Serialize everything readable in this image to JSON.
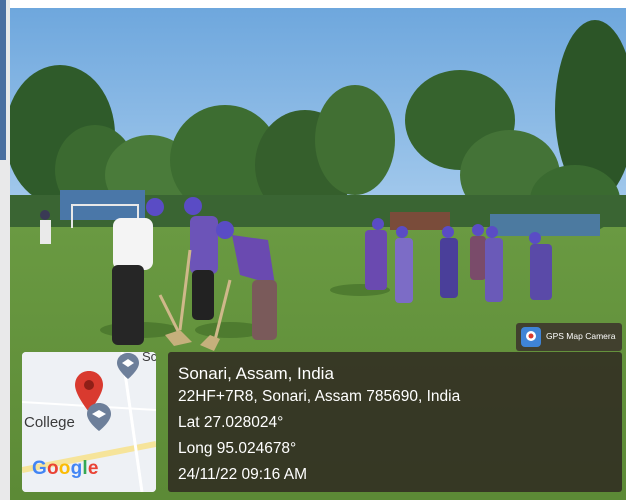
{
  "map": {
    "label_college": "College",
    "label_sc": "Sc",
    "google": [
      "G",
      "o",
      "o",
      "g",
      "l",
      "e"
    ],
    "google_colors": [
      "#4285F4",
      "#EA4335",
      "#FBBC05",
      "#4285F4",
      "#34A853",
      "#EA4335"
    ]
  },
  "badge": {
    "label": "GPS Map Camera"
  },
  "info": {
    "place": "Sonari, Assam, India",
    "address": "22HF+7R8, Sonari, Assam 785690, India",
    "lat": "Lat 27.028024°",
    "long": "Long 95.024678°",
    "datetime": "24/11/22 09:16 AM"
  }
}
